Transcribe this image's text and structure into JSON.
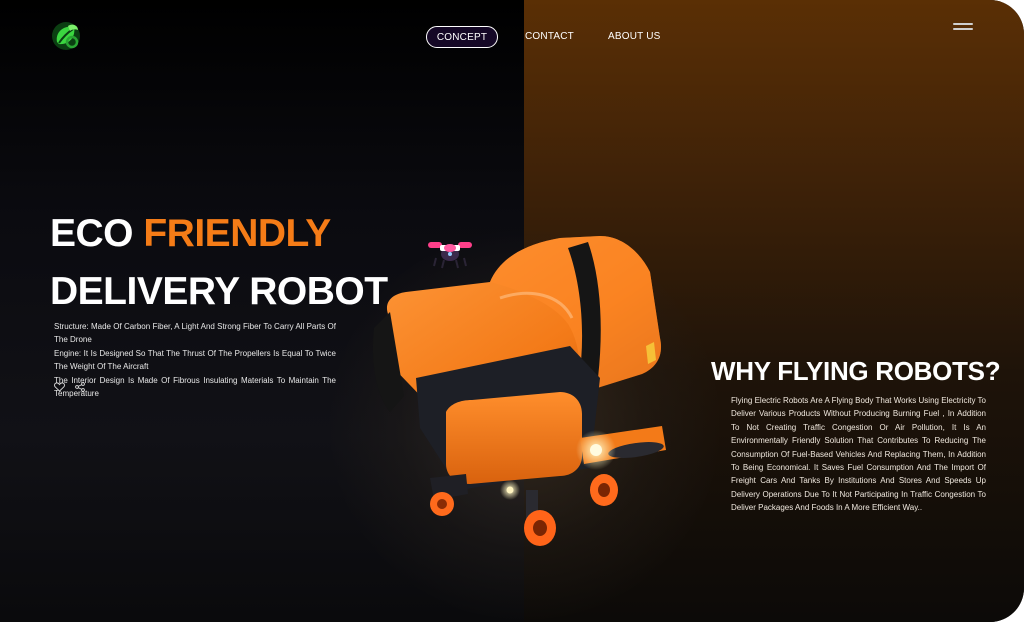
{
  "header": {
    "logo_icon": "leaf-logo-icon",
    "nav": [
      {
        "label": "CONCEPT",
        "active": true
      },
      {
        "label": "CONTACT",
        "active": false
      },
      {
        "label": "ABOUT US",
        "active": false
      }
    ],
    "menu_icon": "hamburger-menu-icon"
  },
  "hero": {
    "title_line1_plain": "ECO ",
    "title_line1_accent": "FRIENDLY",
    "title_line2": "DELIVERY ROBOT",
    "specs": [
      "Structure: Made Of Carbon Fiber, A Light And Strong Fiber To Carry All Parts Of The Drone",
      "Engine: It Is Designed So That The Thrust Of The Propellers Is Equal To Twice The Weight Of The Aircraft",
      "The Interior Design Is Made Of Fibrous Insulating Materials To Maintain The Temperature"
    ],
    "action_icons": [
      "heart-icon",
      "share-icon"
    ]
  },
  "why": {
    "title": "WHY FLYING ROBOTS?",
    "body": "Flying Electric Robots Are A Flying Body That Works Using Electricity To Deliver Various Products Without Producing Burning Fuel , In Addition To Not Creating Traffic Congestion Or Air Pollution, It Is An Environmentally Friendly Solution That Contributes To Reducing The Consumption Of Fuel-Based Vehicles And Replacing Them, In Addition To Being Economical. It Saves Fuel Consumption And The Import Of Freight Cars And Tanks By Institutions And Stores And Speeds Up Delivery Operations Due To It Not Participating In Traffic Congestion To Deliver Packages And Foods In A More Efficient Way.."
  },
  "colors": {
    "accent": "#f57c17",
    "left_bg": "#0b0b10",
    "right_bg": "#5a2f05",
    "nav_active_bg": "#150826"
  }
}
